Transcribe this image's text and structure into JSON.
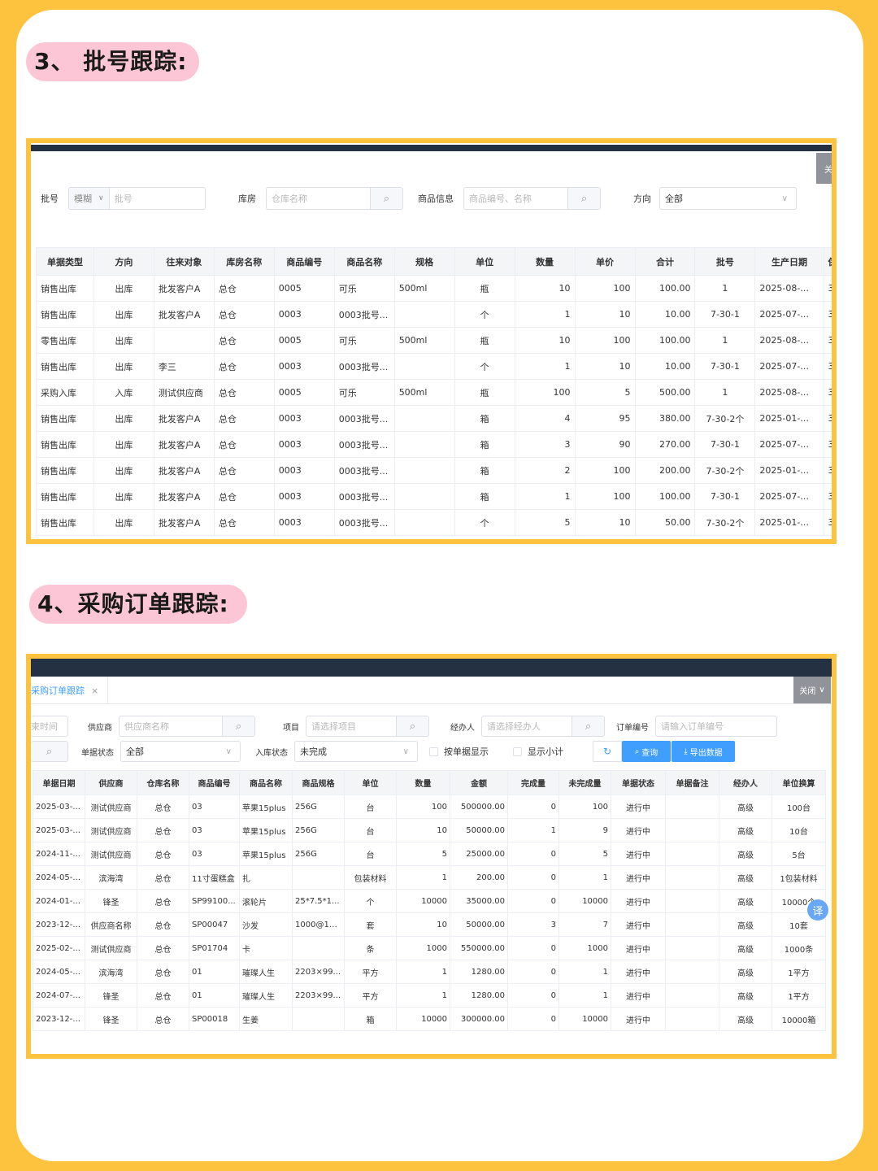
{
  "section3": {
    "title": "3、 批号跟踪:",
    "close_glyph": "关",
    "filters": {
      "batch_label": "批号",
      "batch_mode": "模糊",
      "batch_placeholder": "批号",
      "warehouse_label": "库房",
      "warehouse_placeholder": "仓库名称",
      "product_label": "商品信息",
      "product_placeholder": "商品编号、名称",
      "direction_label": "方向",
      "direction_value": "全部"
    },
    "columns": [
      "单据类型",
      "方向",
      "往来对象",
      "库房名称",
      "商品编号",
      "商品名称",
      "规格",
      "单位",
      "数量",
      "单价",
      "合计",
      "批号",
      "生产日期",
      "保质"
    ],
    "rows": [
      [
        "销售出库",
        "出库",
        "批发客户A",
        "总仓",
        "0005",
        "可乐",
        "500ml",
        "瓶",
        "10",
        "100",
        "100.00",
        "1",
        "2025-08-...",
        "3"
      ],
      [
        "销售出库",
        "出库",
        "批发客户A",
        "总仓",
        "0003",
        "0003批号...",
        "",
        "个",
        "1",
        "10",
        "10.00",
        "7-30-1",
        "2025-07-...",
        "3"
      ],
      [
        "零售出库",
        "出库",
        "",
        "总仓",
        "0005",
        "可乐",
        "500ml",
        "瓶",
        "10",
        "100",
        "100.00",
        "1",
        "2025-08-...",
        "3"
      ],
      [
        "销售出库",
        "出库",
        "李三",
        "总仓",
        "0003",
        "0003批号...",
        "",
        "个",
        "1",
        "10",
        "10.00",
        "7-30-1",
        "2025-07-...",
        "3"
      ],
      [
        "采购入库",
        "入库",
        "测试供应商",
        "总仓",
        "0005",
        "可乐",
        "500ml",
        "瓶",
        "100",
        "5",
        "500.00",
        "1",
        "2025-08-...",
        "3"
      ],
      [
        "销售出库",
        "出库",
        "批发客户A",
        "总仓",
        "0003",
        "0003批号...",
        "",
        "箱",
        "4",
        "95",
        "380.00",
        "7-30-2个",
        "2025-01-...",
        "3"
      ],
      [
        "销售出库",
        "出库",
        "批发客户A",
        "总仓",
        "0003",
        "0003批号...",
        "",
        "箱",
        "3",
        "90",
        "270.00",
        "7-30-1",
        "2025-07-...",
        "3"
      ],
      [
        "销售出库",
        "出库",
        "批发客户A",
        "总仓",
        "0003",
        "0003批号...",
        "",
        "箱",
        "2",
        "100",
        "200.00",
        "7-30-2个",
        "2025-01-...",
        "3"
      ],
      [
        "销售出库",
        "出库",
        "批发客户A",
        "总仓",
        "0003",
        "0003批号...",
        "",
        "箱",
        "1",
        "100",
        "100.00",
        "7-30-1",
        "2025-07-...",
        "3"
      ],
      [
        "销售出库",
        "出库",
        "批发客户A",
        "总仓",
        "0003",
        "0003批号...",
        "",
        "个",
        "5",
        "10",
        "50.00",
        "7-30-2个",
        "2025-01-...",
        "3"
      ]
    ]
  },
  "section4": {
    "title": "4、采购订单跟踪:",
    "tab_label": "采购订单跟踪",
    "tab_close": "×",
    "close_label": "关闭",
    "filters": {
      "time_placeholder": "束时间",
      "supplier_label": "供应商",
      "supplier_placeholder": "供应商名称",
      "project_label": "项目",
      "project_placeholder": "请选择项目",
      "handler_label": "经办人",
      "handler_placeholder": "请选择经办人",
      "order_no_label": "订单编号",
      "order_no_placeholder": "请输入订单编号",
      "doc_status_label": "单据状态",
      "doc_status_value": "全部",
      "stock_status_label": "入库状态",
      "stock_status_value": "未完成",
      "by_doc_label": "按单据显示",
      "subtotal_label": "显示小计",
      "query_label": "查询",
      "export_label": "导出数据"
    },
    "columns": [
      "单据日期",
      "供应商",
      "仓库名称",
      "商品编号",
      "商品名称",
      "商品规格",
      "单位",
      "数量",
      "金额",
      "完成量",
      "未完成量",
      "单据状态",
      "单据备注",
      "经办人",
      "单位换算"
    ],
    "rows": [
      [
        "2025-03-...",
        "测试供应商",
        "总仓",
        "03",
        "苹果15plus",
        "256G",
        "台",
        "100",
        "500000.00",
        "0",
        "100",
        "进行中",
        "",
        "高级",
        "100台"
      ],
      [
        "2025-03-...",
        "测试供应商",
        "总仓",
        "03",
        "苹果15plus",
        "256G",
        "台",
        "10",
        "50000.00",
        "1",
        "9",
        "进行中",
        "",
        "高级",
        "10台"
      ],
      [
        "2024-11-...",
        "测试供应商",
        "总仓",
        "03",
        "苹果15plus",
        "256G",
        "台",
        "5",
        "25000.00",
        "0",
        "5",
        "进行中",
        "",
        "高级",
        "5台"
      ],
      [
        "2024-05-...",
        "滨海湾",
        "总仓",
        "11寸蛋糕盒",
        "扎",
        "",
        "包装材料",
        "1",
        "200.00",
        "0",
        "1",
        "进行中",
        "",
        "高级",
        "1包装材料"
      ],
      [
        "2024-01-...",
        "锋圣",
        "总仓",
        "SP99100...",
        "滚轮片",
        "25*7.5*1...",
        "个",
        "10000",
        "35000.00",
        "0",
        "10000",
        "进行中",
        "",
        "高级",
        "10000个"
      ],
      [
        "2023-12-...",
        "供应商名称",
        "总仓",
        "SP00047",
        "沙发",
        "1000@10...",
        "套",
        "10",
        "50000.00",
        "3",
        "7",
        "进行中",
        "",
        "高级",
        "10套"
      ],
      [
        "2025-02-...",
        "测试供应商",
        "总仓",
        "SP01704",
        "卡",
        "",
        "条",
        "1000",
        "550000.00",
        "0",
        "1000",
        "进行中",
        "",
        "高级",
        "1000条"
      ],
      [
        "2024-05-...",
        "滨海湾",
        "总仓",
        "01",
        "璀璨人生",
        "2203×99...",
        "平方",
        "1",
        "1280.00",
        "0",
        "1",
        "进行中",
        "",
        "高级",
        "1平方"
      ],
      [
        "2024-07-...",
        "锋圣",
        "总仓",
        "01",
        "璀璨人生",
        "2203×99...",
        "平方",
        "1",
        "1280.00",
        "0",
        "1",
        "进行中",
        "",
        "高级",
        "1平方"
      ],
      [
        "2023-12-...",
        "锋圣",
        "总仓",
        "SP00018",
        "生姜",
        "",
        "箱",
        "10000",
        "300000.00",
        "0",
        "10000",
        "进行中",
        "",
        "高级",
        "10000箱"
      ]
    ],
    "translate_glyph": "译"
  }
}
